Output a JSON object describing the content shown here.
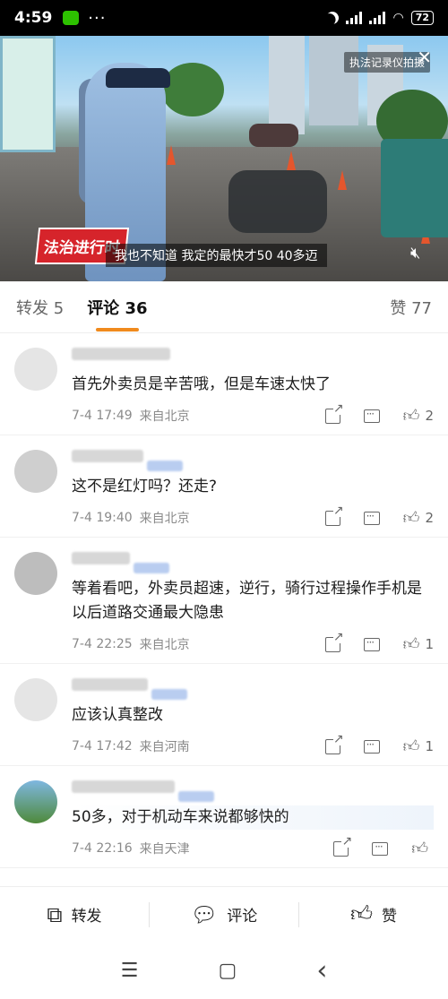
{
  "status_bar": {
    "time": "4:59",
    "dots": "···",
    "battery": "72"
  },
  "video": {
    "watermark": "执法记录仪拍摄",
    "logo": "法治进行时",
    "subtitle": "我也不知道 我定的最快才50 40多迈"
  },
  "tabs": [
    {
      "label": "转发 5"
    },
    {
      "label": "评论 36"
    },
    {
      "label": "赞 77"
    }
  ],
  "comments": [
    {
      "text": "首先外卖员是辛苦哦，但是车速太快了",
      "time": "7-4 17:49",
      "location": "来自北京",
      "likes": "2"
    },
    {
      "text": "这不是红灯吗？还走?",
      "time": "7-4 19:40",
      "location": "来自北京",
      "likes": "2"
    },
    {
      "text": "等着看吧，外卖员超速，逆行，骑行过程操作手机是以后道路交通最大隐患",
      "time": "7-4 22:25",
      "location": "来自北京",
      "likes": "1"
    },
    {
      "text": "应该认真整改",
      "time": "7-4 17:42",
      "location": "来自河南",
      "likes": "1"
    },
    {
      "text": "50多，对于机动车来说都够快的",
      "time": "7-4 22:16",
      "location": "来自天津",
      "likes": ""
    }
  ],
  "bottom_bar": {
    "share": "转发",
    "comment": "评论",
    "like": "赞"
  },
  "nav": {
    "menu": "☰",
    "home": "▢",
    "back": "‹"
  }
}
